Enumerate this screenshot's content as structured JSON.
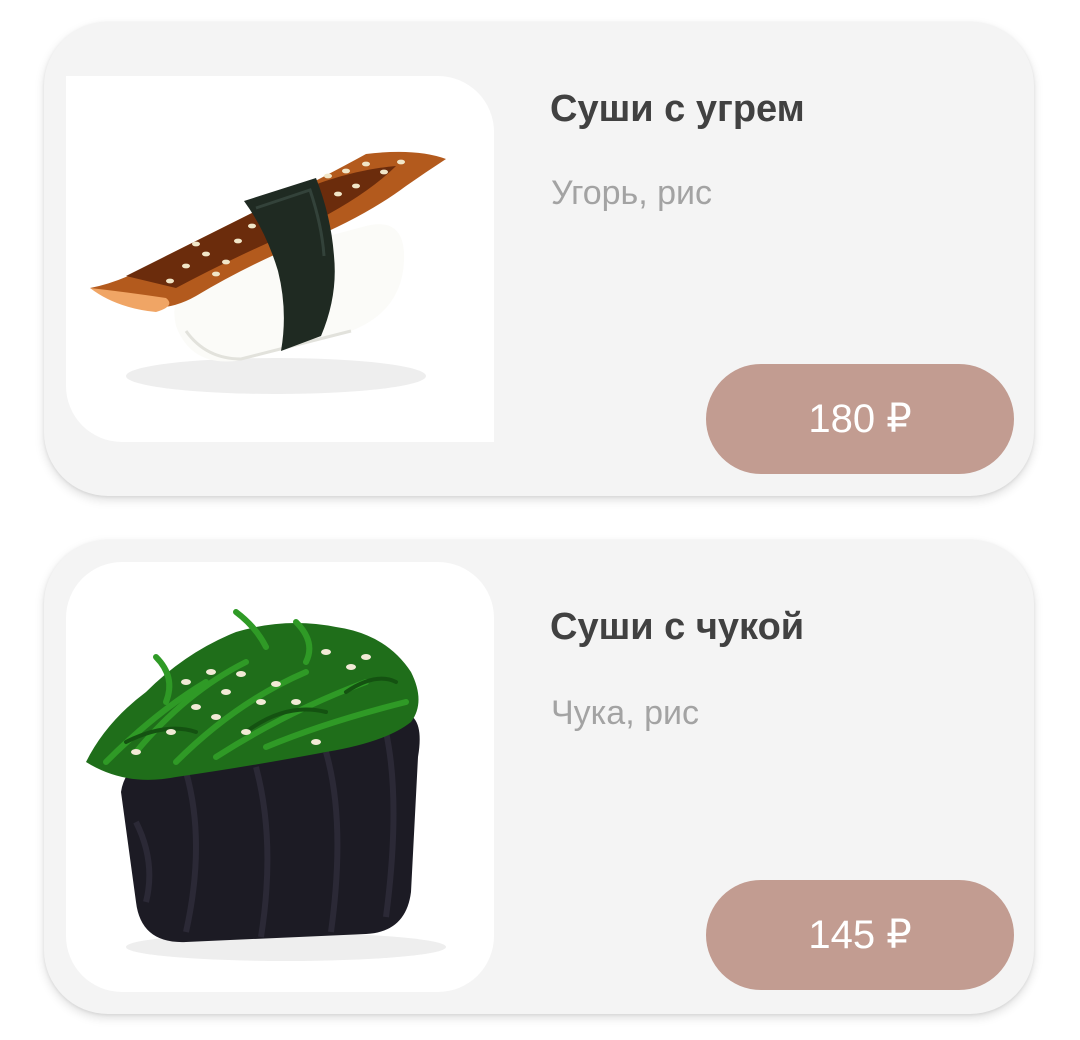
{
  "products": [
    {
      "name": "Суши с угрем",
      "ingredients": "Угорь, рис",
      "price": "180 ₽",
      "image": "eel-sushi-icon"
    },
    {
      "name": "Суши с чукой",
      "ingredients": "Чука, рис",
      "price": "145 ₽",
      "image": "chuka-sushi-icon"
    }
  ],
  "colors": {
    "card_background": "#f4f4f4",
    "title": "#414141",
    "subtitle": "#a3a3a3",
    "price_button": "#c29c91",
    "price_text": "#ffffff"
  }
}
